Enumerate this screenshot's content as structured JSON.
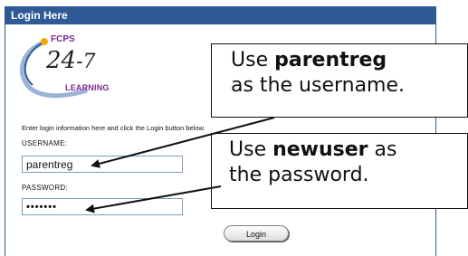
{
  "header": {
    "title": "Login Here"
  },
  "logo": {
    "org": "FCPS",
    "number": "24",
    "number_suffix": "-7",
    "tagline": "LEARNING"
  },
  "form": {
    "instructions": "Enter login information here and click the Login button below.",
    "username_label": "USERNAME:",
    "username_value": "parentreg",
    "password_label": "PASSWORD:",
    "password_value": "•••••••",
    "login_label": "Login"
  },
  "callouts": [
    {
      "line1_pre": "Use ",
      "line1_bold": "parentreg",
      "line1_post": "",
      "line2": "as the username."
    },
    {
      "line1_pre": "Use ",
      "line1_bold": "newuser",
      "line1_post": " as",
      "line2": "the password."
    }
  ],
  "colors": {
    "header": "#2f5a95",
    "logo_accent": "#7a2a8a"
  }
}
